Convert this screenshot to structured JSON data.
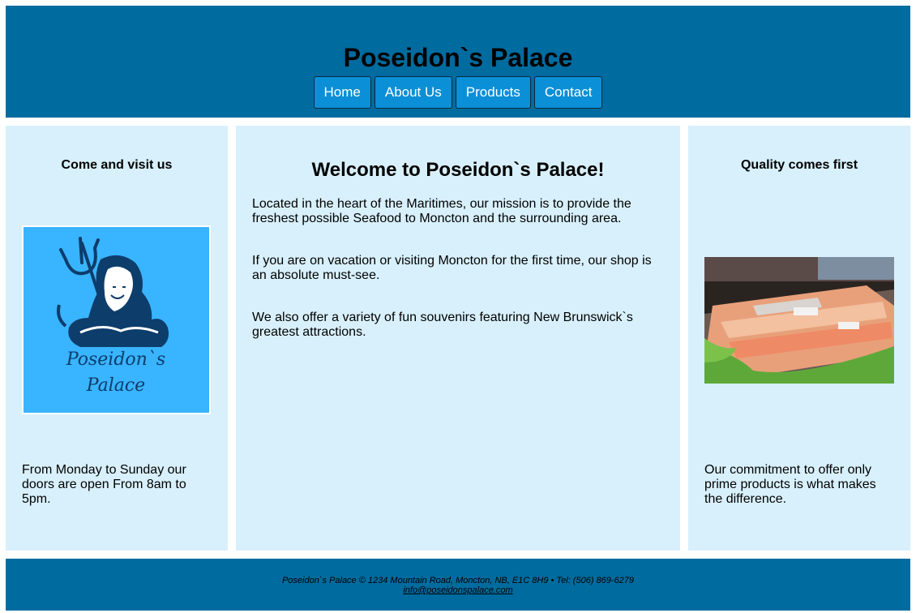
{
  "header": {
    "title": "Poseidon`s Palace",
    "nav": [
      "Home",
      "About Us",
      "Products",
      "Contact"
    ]
  },
  "left": {
    "heading": "Come and visit us",
    "logo_text_line1": "Poseidon`s",
    "logo_text_line2": "Palace",
    "text": "From Monday to Sunday our doors are open From 8am to 5pm."
  },
  "center": {
    "heading": "Welcome to Poseidon`s Palace!",
    "paragraphs": [
      "Located in the heart of the Maritimes, our mission is to provide the freshest possible Seafood to Moncton and the surrounding area.",
      "If you are on vacation or visiting Moncton for the first time, our shop is an absolute must-see.",
      "We also offer a variety of fun souvenirs featuring New Brunswick`s greatest attractions."
    ]
  },
  "right": {
    "heading": "Quality comes first",
    "text": "Our commitment to offer only prime products is what makes the difference."
  },
  "footer": {
    "line": "Poseidon`s Palace © 1234 Mountain Road, Moncton, NB, E1C 8H9 • Tel: (506) 869-6279",
    "email": "info@poseidonspalace.com"
  },
  "colors": {
    "header_bg": "#006b9e",
    "nav_button": "#0b8fd6",
    "panel_bg": "#d8f0fb",
    "logo_bg": "#39b4ff"
  }
}
